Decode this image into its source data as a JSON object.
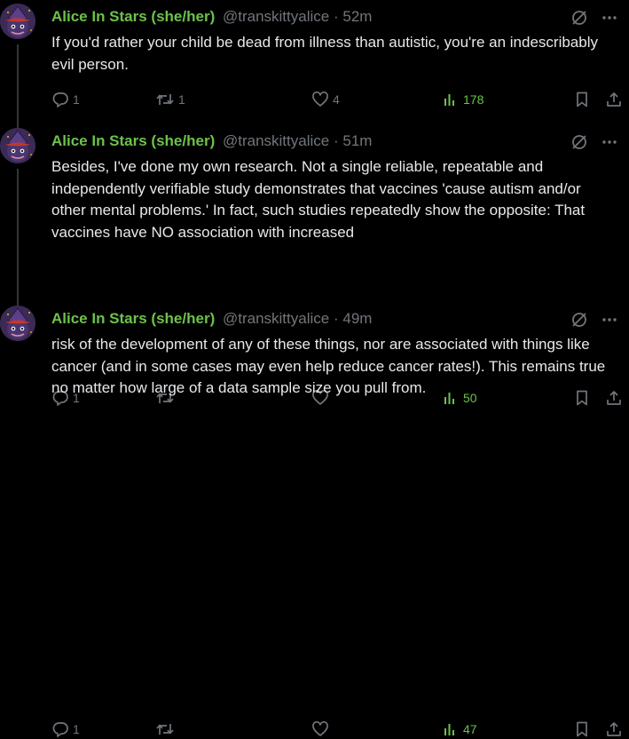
{
  "colors": {
    "background": "#000000",
    "name": "#6cc24a",
    "muted": "#71767b",
    "text": "#e7e9ea",
    "views": "#6cc24a",
    "thread_line": "#333639"
  },
  "icons": {
    "reply": "reply-icon",
    "retweet": "retweet-icon",
    "like": "heart-icon",
    "views": "views-icon",
    "bookmark": "bookmark-icon",
    "share": "share-icon",
    "grok": "grok-icon",
    "more": "more-icon"
  },
  "tweets": [
    {
      "name": "Alice In Stars (she/her)",
      "handle": "@transkittyalice",
      "separator": "·",
      "time": "52m",
      "text": "If you'd rather your child be dead from illness than autistic, you're an indescribably evil person.",
      "replies": "1",
      "retweets": "1",
      "likes": "4",
      "views": "178"
    },
    {
      "name": "Alice In Stars (she/her)",
      "handle": "@transkittyalice",
      "separator": "·",
      "time": "51m",
      "text": "Besides, I've done my own research. Not a single reliable, repeatable and independently verifiable study demonstrates that vaccines 'cause autism and/or other mental problems.' In fact, such studies repeatedly show the opposite: That vaccines have NO association with increased",
      "replies": "1",
      "retweets": "",
      "likes": "",
      "views": "50"
    },
    {
      "name": "Alice In Stars (she/her)",
      "handle": "@transkittyalice",
      "separator": "·",
      "time": "49m",
      "text": "risk of the development of any of these things, nor are associated with things like cancer (and in some cases may even help reduce cancer rates!). This remains true no matter how large of a data sample size you pull from.",
      "replies": "1",
      "retweets": "",
      "likes": "",
      "views": "47"
    }
  ]
}
